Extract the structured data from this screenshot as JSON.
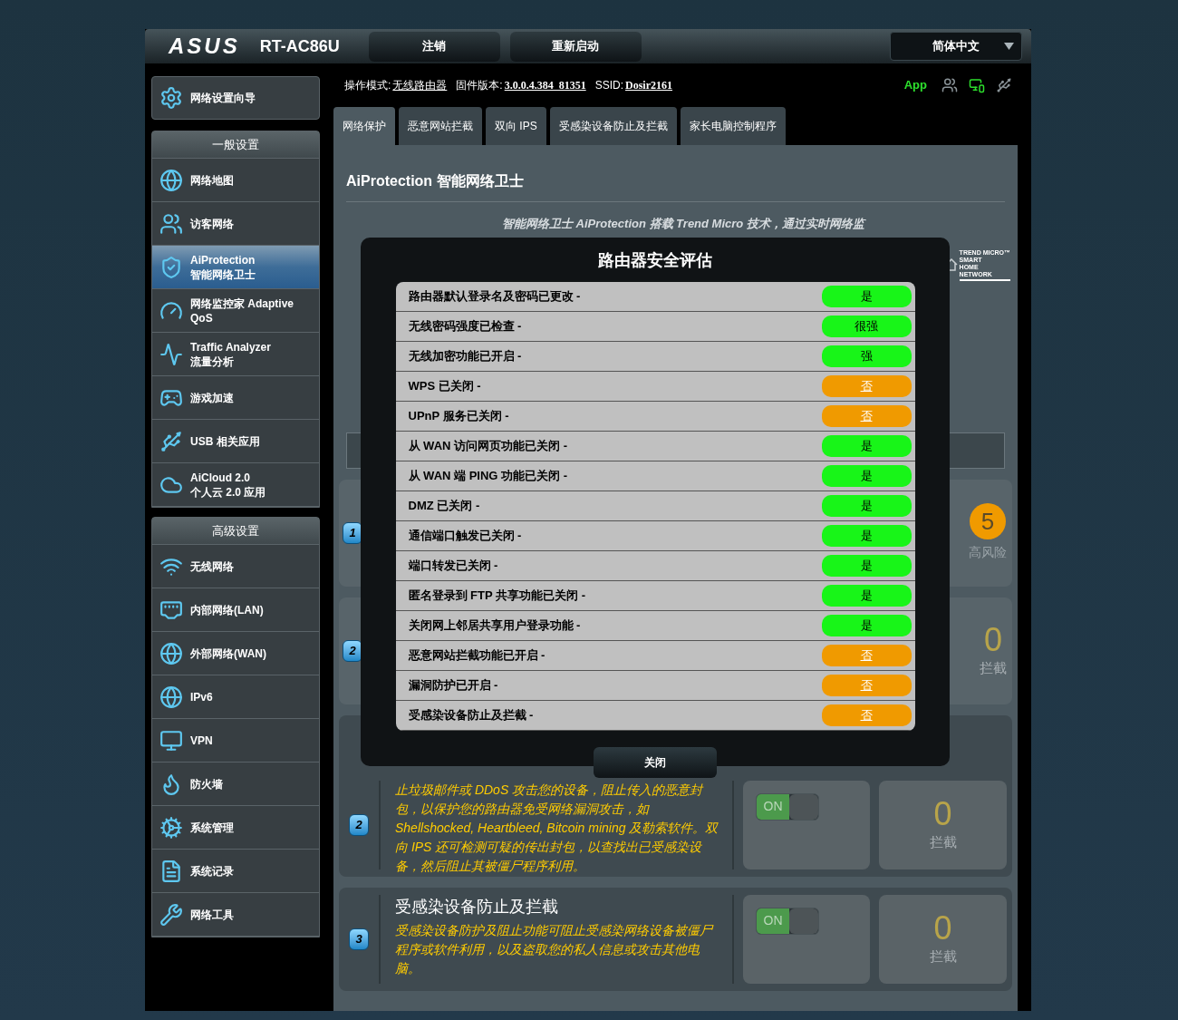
{
  "header": {
    "logo": "ASUS",
    "model": "RT-AC86U",
    "buttons": [
      "注销",
      "重新启动"
    ],
    "language": "简体中文"
  },
  "sidebar": {
    "setup": "网络设置向导",
    "groups": [
      {
        "title": "一般设置",
        "items": [
          {
            "label": "网络地图",
            "selected": false
          },
          {
            "label": "访客网络",
            "selected": false
          },
          {
            "label": "AiProtection",
            "sublabel": "智能网络卫士",
            "selected": true
          },
          {
            "label": "网络监控家 Adaptive QoS",
            "selected": false
          },
          {
            "label": "Traffic Analyzer",
            "sublabel": "流量分析",
            "selected": false
          },
          {
            "label": "游戏加速",
            "selected": false
          },
          {
            "label": "USB 相关应用",
            "selected": false
          },
          {
            "label": "AiCloud 2.0",
            "sublabel": "个人云 2.0 应用",
            "selected": false
          }
        ]
      },
      {
        "title": "高级设置",
        "items": [
          {
            "label": "无线网络",
            "selected": false
          },
          {
            "label": "内部网络(LAN)",
            "selected": false
          },
          {
            "label": "外部网络(WAN)",
            "selected": false
          },
          {
            "label": "IPv6",
            "selected": false
          },
          {
            "label": "VPN",
            "selected": false
          },
          {
            "label": "防火墙",
            "selected": false
          },
          {
            "label": "系统管理",
            "selected": false
          },
          {
            "label": "系统记录",
            "selected": false
          },
          {
            "label": "网络工具",
            "selected": false
          }
        ]
      }
    ]
  },
  "status_line": {
    "items": [
      {
        "label": "操作模式:",
        "value": "无线路由器"
      },
      {
        "label": "固件版本:",
        "value": "3.0.0.4.384_81351"
      },
      {
        "label": "SSID:",
        "value": "Dosir2161"
      }
    ],
    "app_label": "App"
  },
  "tabs": [
    {
      "label": "网络保护",
      "selected": true
    },
    {
      "label": "恶意网站拦截",
      "selected": false
    },
    {
      "label": "双向 IPS",
      "selected": false
    },
    {
      "label": "受感染设备防止及拦截",
      "selected": false
    },
    {
      "label": "家长电脑控制程序",
      "selected": false
    }
  ],
  "page": {
    "title": "AiProtection 智能网络卫士",
    "intro": "智能网络卫士 AiProtection 搭载 Trend Micro 技术，通过实时网络监",
    "logo_lines": [
      "TREND MICRO™",
      "SMART",
      "HOME",
      "NETWORK"
    ],
    "cards": [
      {
        "kind": "partial",
        "number": "1",
        "stat": {
          "kind": "risk",
          "value": "5",
          "label": "高风险"
        }
      },
      {
        "kind": "partial",
        "number": "2",
        "stat": {
          "kind": "count",
          "value": "0",
          "label": "拦截"
        }
      },
      {
        "kind": "feature",
        "number": "2",
        "description": "止垃圾邮件或 DDoS 攻击您的设备，阻止传入的恶意封包，以保护您的路由器免受网络漏洞攻击，如 Shellshocked, Heartbleed, Bitcoin mining 及勒索软件。双向 IPS 还可检测可疑的传出封包，以查找出已受感染设备，然后阻止其被僵尸程序利用。",
        "toggle": {
          "label": "ON",
          "on": true
        },
        "stat": {
          "kind": "count",
          "value": "0",
          "label": "拦截"
        }
      },
      {
        "kind": "feature",
        "number": "3",
        "title": "受感染设备防止及拦截",
        "description": "受感染设备防护及阻止功能可阻止受感染网络设备被僵尸程序或软件利用，以及盗取您的私人信息或攻击其他电脑。",
        "toggle": {
          "label": "ON",
          "on": true
        },
        "stat": {
          "kind": "count",
          "value": "0",
          "label": "拦截"
        }
      }
    ]
  },
  "dialog": {
    "title": "路由器安全评估",
    "checks": [
      {
        "label": "路由器默认登录名及密码已更改 -",
        "value": "是",
        "passed": true
      },
      {
        "label": "无线密码强度已检查 -",
        "value": "很强",
        "passed": true
      },
      {
        "label": "无线加密功能已开启 -",
        "value": "强",
        "passed": true
      },
      {
        "label": "WPS 已关闭 -",
        "value": "否",
        "passed": false
      },
      {
        "label": "UPnP 服务已关闭 -",
        "value": "否",
        "passed": false
      },
      {
        "label": "从 WAN 访问网页功能已关闭 -",
        "value": "是",
        "passed": true
      },
      {
        "label": "从 WAN 端 PING 功能已关闭 -",
        "value": "是",
        "passed": true
      },
      {
        "label": "DMZ 已关闭 -",
        "value": "是",
        "passed": true
      },
      {
        "label": "通信端口触发已关闭 -",
        "value": "是",
        "passed": true
      },
      {
        "label": "端口转发已关闭 -",
        "value": "是",
        "passed": true
      },
      {
        "label": "匿名登录到 FTP 共享功能已关闭 -",
        "value": "是",
        "passed": true
      },
      {
        "label": "关闭网上邻居共享用户登录功能 -",
        "value": "是",
        "passed": true
      },
      {
        "label": "恶意网站拦截功能已开启 -",
        "value": "否",
        "passed": false
      },
      {
        "label": "漏洞防护已开启 -",
        "value": "否",
        "passed": false
      },
      {
        "label": "受感染设备防止及拦截 -",
        "value": "否",
        "passed": false
      }
    ],
    "close_button": "关闭"
  }
}
